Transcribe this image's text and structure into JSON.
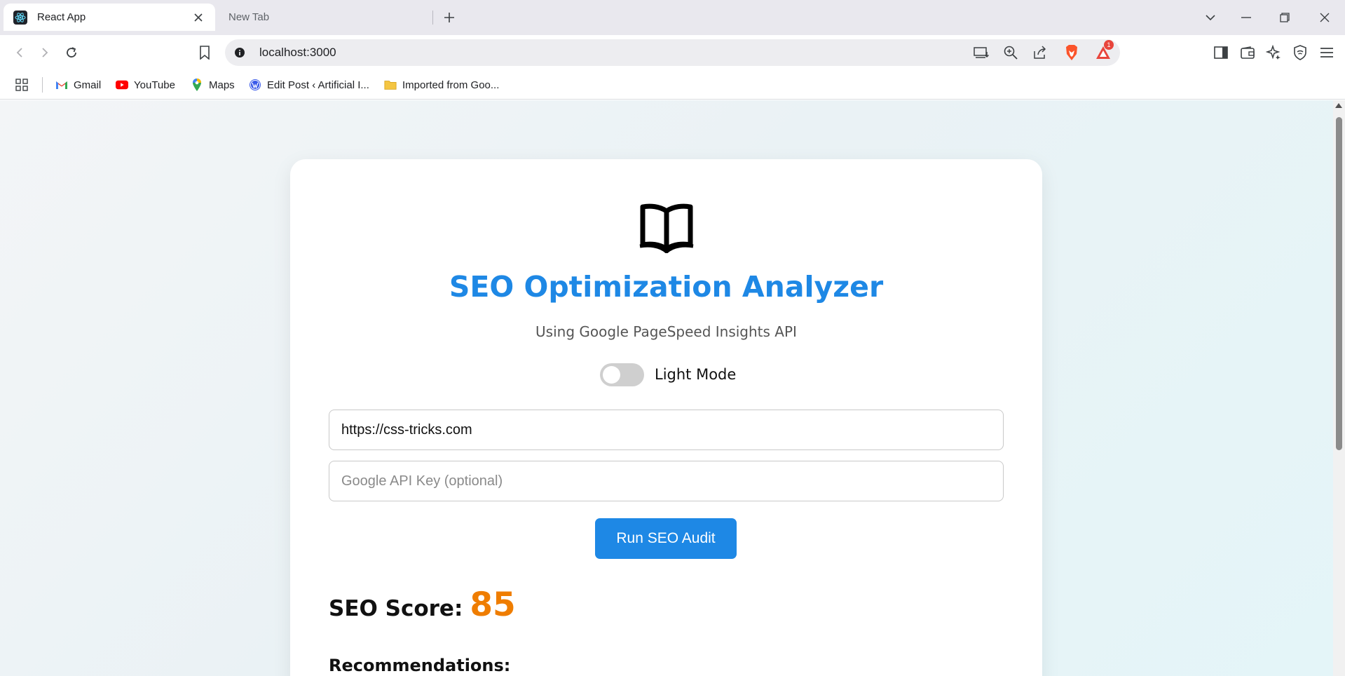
{
  "browser": {
    "tabs": [
      {
        "title": "React App",
        "active": true
      },
      {
        "title": "New Tab",
        "active": false
      }
    ],
    "address": "localhost:3000",
    "bookmarks": [
      {
        "label": "Gmail"
      },
      {
        "label": "YouTube"
      },
      {
        "label": "Maps"
      },
      {
        "label": "Edit Post ‹ Artificial I..."
      },
      {
        "label": "Imported from Goo..."
      }
    ],
    "notification_count": "1"
  },
  "app": {
    "title": "SEO Optimization Analyzer",
    "subtitle": "Using Google PageSpeed Insights API",
    "theme_toggle_label": "Light Mode",
    "url_value": "https://css-tricks.com",
    "api_key_placeholder": "Google API Key (optional)",
    "run_button": "Run SEO Audit",
    "score_label": "SEO Score:",
    "score_value": "85",
    "recommendations_heading": "Recommendations:"
  },
  "colors": {
    "accent": "#1e88e5",
    "score": "#ef7d00",
    "toggle_off": "#cfcfcf"
  }
}
